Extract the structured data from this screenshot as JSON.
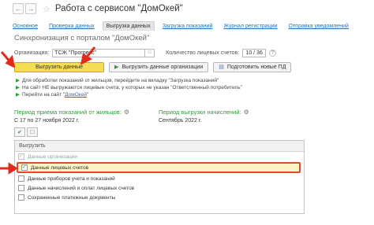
{
  "window": {
    "title": "Работа с сервисом \"ДомОкей\""
  },
  "tabs": [
    {
      "label": "Основное",
      "active": false
    },
    {
      "label": "Проверка данных",
      "active": false
    },
    {
      "label": "Выгрузка данных",
      "active": true
    },
    {
      "label": "Загрузка показаний",
      "active": false
    },
    {
      "label": "Журнал регистрации",
      "active": false
    },
    {
      "label": "Отправка уведомлений",
      "active": false
    }
  ],
  "section": {
    "title": "Синхронизация с порталом \"ДомОкей\""
  },
  "organization": {
    "label": "Организация:",
    "value": "ТСЖ \"Прогресс\""
  },
  "accounts": {
    "label": "Количество лицевых счетов:",
    "value": "10 / 36"
  },
  "toolbar": {
    "upload": "Выгрузить данные",
    "upload_org": "Выгрузить данные организации",
    "prepare": "Подготовить новые ПД"
  },
  "hints": {
    "h1": "Для обработки показаний от жильцов, перейдите на вкладку \"Загрузка показаний\"",
    "h2": "На сайт НЕ выгружаются лицевые счета, у которых не указан \"Ответственный потребитель\"",
    "h3_prefix": "Перейти на сайт",
    "h3_link": "ДомОкей"
  },
  "periods": {
    "readings_label": "Период приема показаний от жильцов:",
    "readings_value": "С 17 по 27 ноября 2022 г.",
    "charges_label": "Период выгрузки начислений:",
    "charges_value": "Сентябрь 2022 г."
  },
  "list": {
    "header": "Выгрузить",
    "items": [
      {
        "label": "Данные организации",
        "checked": true,
        "dim": true
      },
      {
        "label": "Данные лицевых счетов",
        "checked": true,
        "highlighted": true
      },
      {
        "label": "Данные приборов учета и показаний",
        "checked": false
      },
      {
        "label": "Данные начислений и оплат лицевых счетов",
        "checked": false
      },
      {
        "label": "Сохраненные платежные документы",
        "checked": false
      }
    ]
  },
  "colors": {
    "accent_button": "#f4dd55",
    "highlight_border": "#e14a2c",
    "link": "#2d6db5",
    "green": "#2e9d39"
  }
}
